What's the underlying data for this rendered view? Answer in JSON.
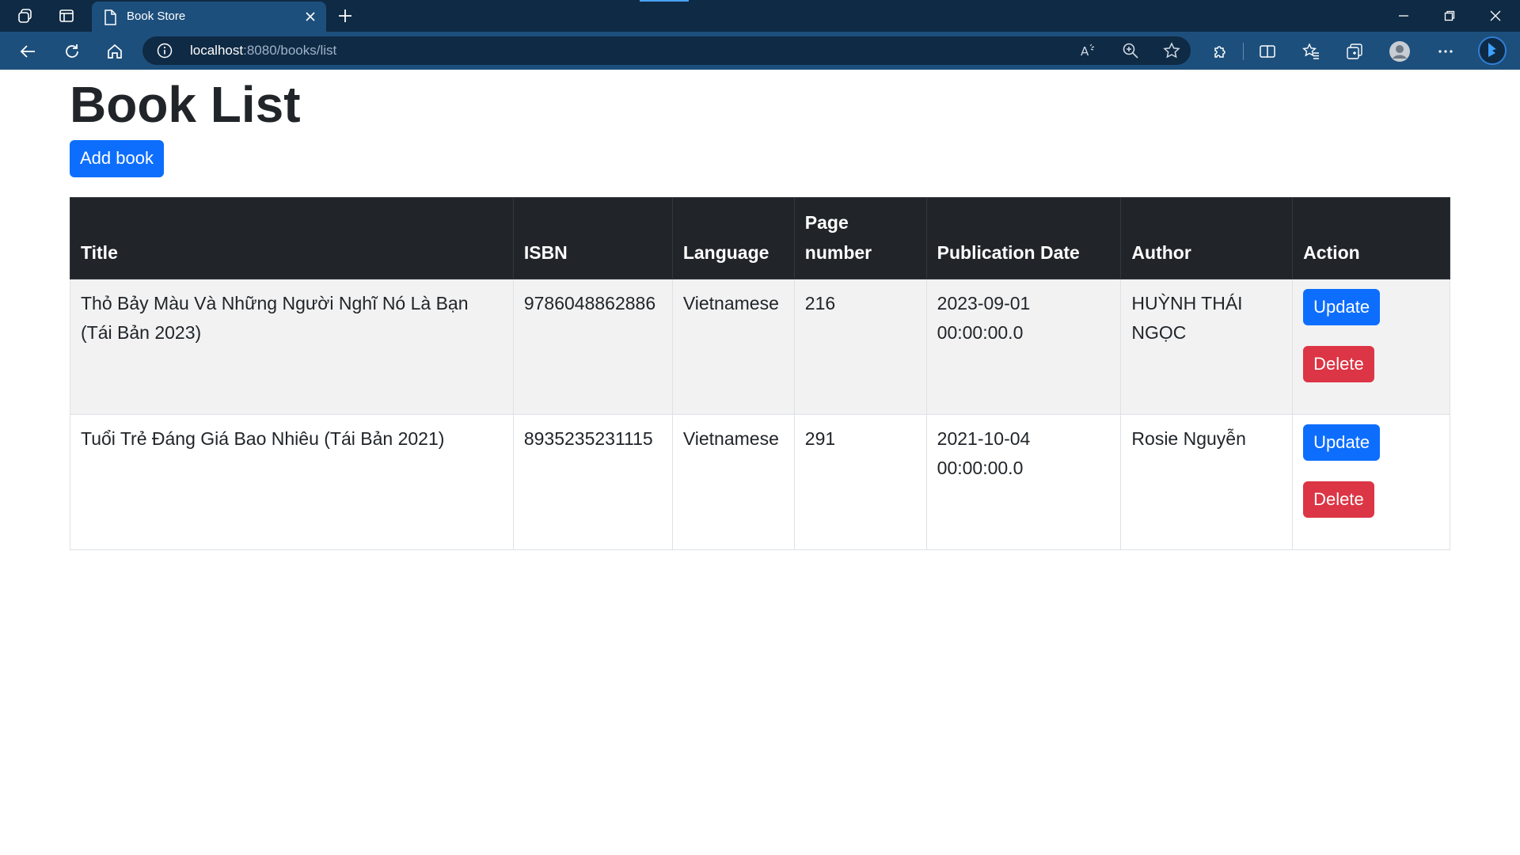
{
  "browser": {
    "tab_title": "Book Store",
    "url_host": "localhost",
    "url_rest": ":8080/books/list"
  },
  "page": {
    "title": "Book List",
    "add_button": "Add book"
  },
  "table": {
    "headers": [
      "Title",
      "ISBN",
      "Language",
      "Page number",
      "Publication Date",
      "Author",
      "Action"
    ],
    "rows": [
      {
        "title": "Thỏ Bảy Màu Và Những Người Nghĩ Nó Là Bạn (Tái Bản 2023)",
        "isbn": "9786048862886",
        "language": "Vietnamese",
        "pages": "216",
        "publication_date": "2023-09-01 00:00:00.0",
        "author": "HUỲNH THÁI NGỌC",
        "update_label": "Update",
        "delete_label": "Delete"
      },
      {
        "title": "Tuổi Trẻ Đáng Giá Bao Nhiêu (Tái Bản 2021)",
        "isbn": "8935235231115",
        "language": "Vietnamese",
        "pages": "291",
        "publication_date": "2021-10-04 00:00:00.0",
        "author": "Rosie Nguyễn",
        "update_label": "Update",
        "delete_label": "Delete"
      }
    ]
  },
  "colors": {
    "primary": "#0d6efd",
    "danger": "#dc3545",
    "table_header": "#212529",
    "chrome_dark": "#0f2a44",
    "chrome": "#1d4f7c"
  },
  "icons": {
    "titlebar": [
      "workspaces-icon",
      "tab-actions-icon"
    ],
    "nav": [
      "back-icon",
      "refresh-icon",
      "home-icon"
    ],
    "address": [
      "info-icon",
      "read-aloud-icon",
      "zoom-icon",
      "favorite-star-icon"
    ],
    "right": [
      "extensions-icon",
      "split-screen-icon",
      "favorites-icon",
      "collections-icon",
      "profile-icon",
      "more-icon",
      "copilot-icon"
    ]
  }
}
